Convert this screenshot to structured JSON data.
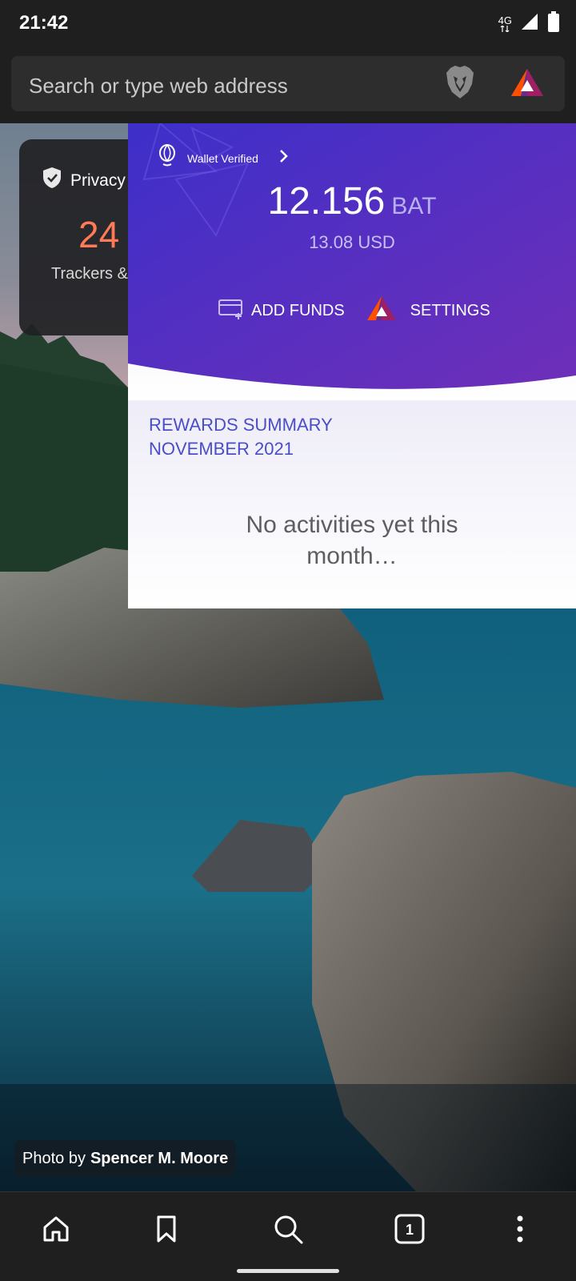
{
  "status_bar": {
    "time": "21:42",
    "network": "4G",
    "icons": [
      "4g-signal-icon",
      "cell-signal-icon",
      "battery-icon"
    ]
  },
  "url_bar": {
    "placeholder": "Search or type web address",
    "shields_icon": "brave-lion-icon",
    "rewards_icon": "bat-triangle-icon"
  },
  "privacy_card": {
    "title": "Privacy",
    "count_partial": "24",
    "label": "Trackers & Ads Blocked",
    "count_color": "#ff7a55"
  },
  "rewards": {
    "wallet_status": "Wallet Verified",
    "balance_amount": "12.156",
    "balance_unit": "BAT",
    "fiat_value": "13.08 USD",
    "add_funds_label": "ADD FUNDS",
    "settings_label": "SETTINGS",
    "summary_title_line1": "REWARDS SUMMARY",
    "summary_title_line2": "NOVEMBER 2021",
    "empty_message": "No activities yet this month…",
    "header_gradient": [
      "#3d2fc9",
      "#6f2fb8"
    ],
    "summary_color": "#4b4dc8"
  },
  "photo_credit": {
    "prefix": "Photo by",
    "name": "Spencer M. Moore"
  },
  "toolbar": {
    "tab_count": "1",
    "icons": [
      "home-icon",
      "bookmark-icon",
      "search-icon",
      "tabs-icon",
      "menu-icon"
    ]
  }
}
